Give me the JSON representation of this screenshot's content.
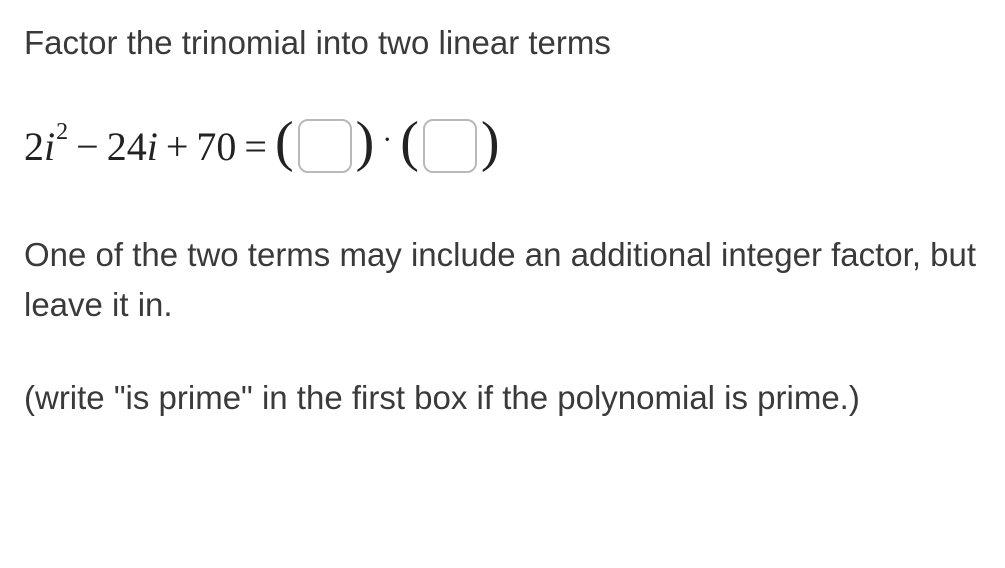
{
  "question": {
    "prompt": "Factor the trinomial into two linear terms",
    "expression": {
      "coef1": "2",
      "var1": "i",
      "exp1": "2",
      "op1": "−",
      "coef2": "24",
      "var2": "i",
      "op2": "+",
      "const": "70",
      "equals": "="
    },
    "hint": "One of the two terms may include an additional integer factor, but leave it in.",
    "prime_note": "(write \"is prime\" in the first box if the polynomial is prime.)",
    "input1_value": "",
    "input2_value": ""
  }
}
